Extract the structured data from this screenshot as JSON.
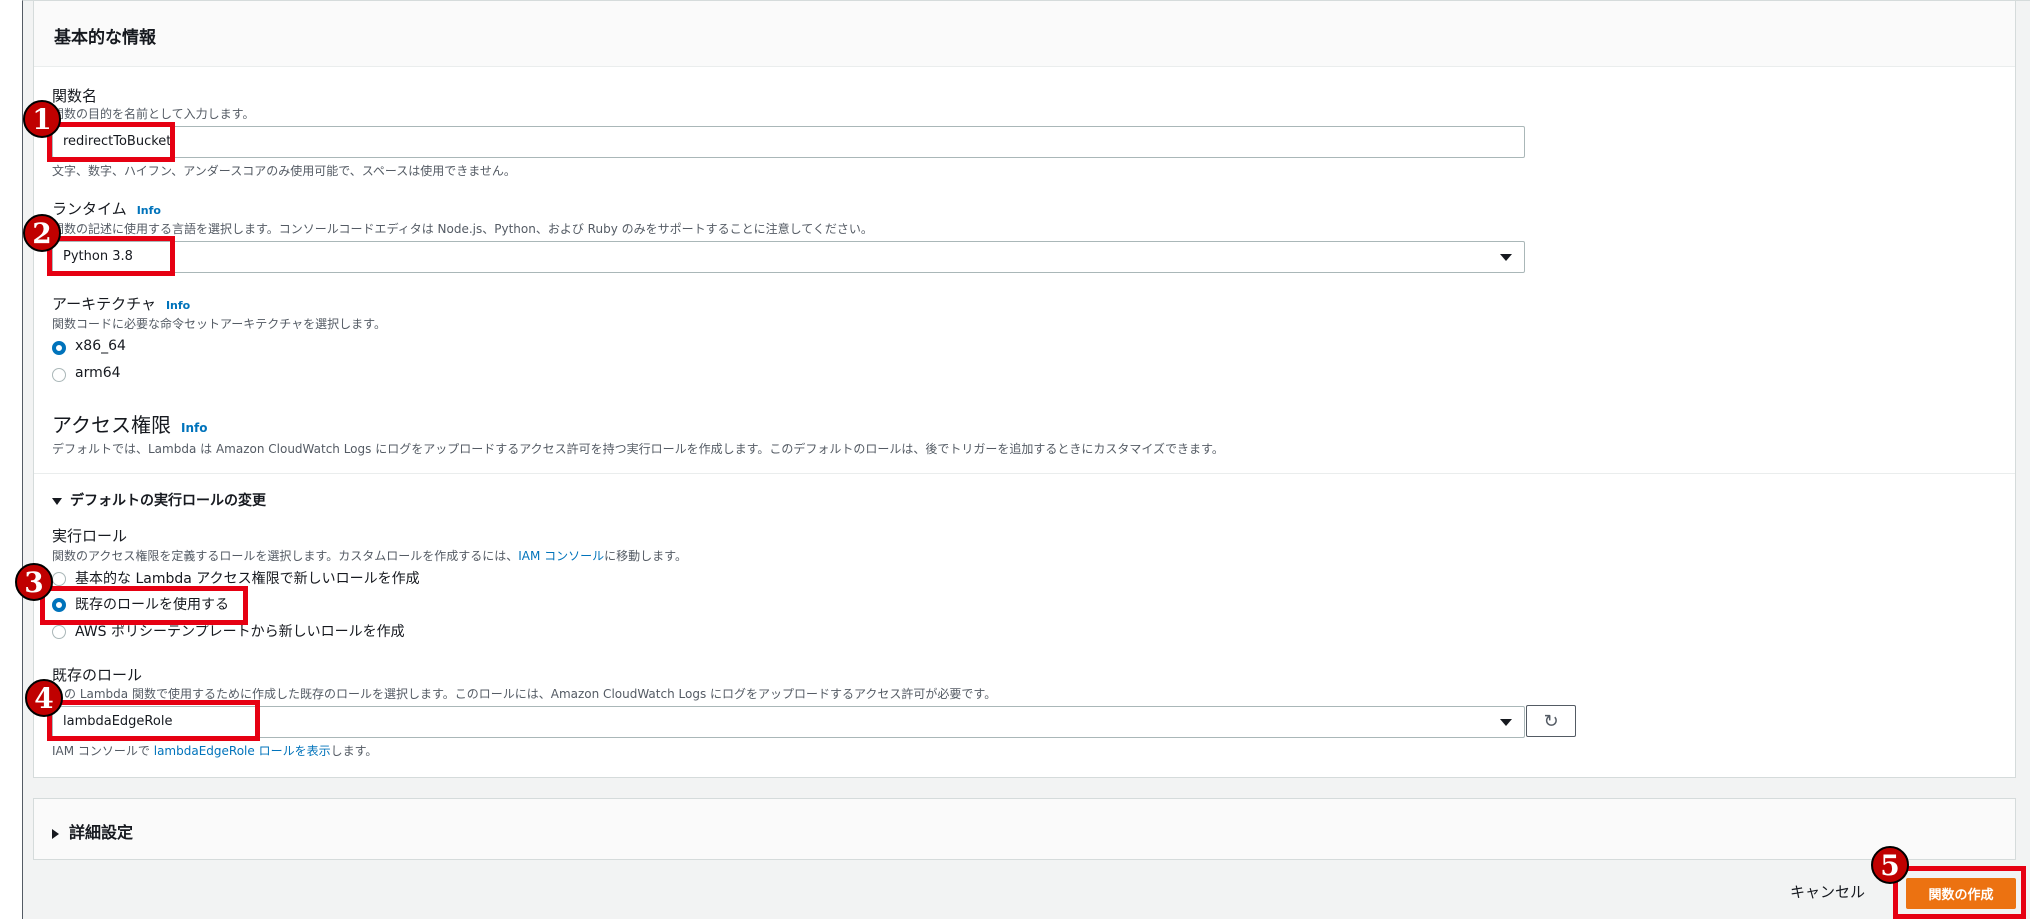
{
  "section": {
    "title": "基本的な情報"
  },
  "function_name": {
    "label": "関数名",
    "description": "関数の目的を名前として入力します。",
    "value": "redirectToBucket",
    "hint": "文字、数字、ハイフン、アンダースコアのみ使用可能で、スペースは使用できません。"
  },
  "runtime": {
    "label": "ランタイム",
    "info": "Info",
    "description": "関数の記述に使用する言語を選択します。コンソールコードエディタは Node.js、Python、および Ruby のみをサポートすることに注意してください。",
    "value": "Python 3.8"
  },
  "architecture": {
    "label": "アーキテクチャ",
    "info": "Info",
    "description": "関数コードに必要な命令セットアーキテクチャを選択します。",
    "options": [
      "x86_64",
      "arm64"
    ],
    "selected": "x86_64"
  },
  "permissions": {
    "title": "アクセス権限",
    "info": "Info",
    "description": "デフォルトでは、Lambda は Amazon CloudWatch Logs にログをアップロードするアクセス許可を持つ実行ロールを作成します。このデフォルトのロールは、後でトリガーを追加するときにカスタマイズできます。"
  },
  "default_role_toggle": "デフォルトの実行ロールの変更",
  "execution_role": {
    "label": "実行ロール",
    "description_prefix": "関数のアクセス権限を定義するロールを選択します。カスタムロールを作成するには、",
    "description_link": "IAM コンソール",
    "description_suffix": "に移動します。",
    "options": [
      "基本的な Lambda アクセス権限で新しいロールを作成",
      "既存のロールを使用する",
      "AWS ポリシーテンプレートから新しいロールを作成"
    ],
    "selected": "既存のロールを使用する"
  },
  "existing_role": {
    "label": "既存のロール",
    "description": "この Lambda 関数で使用するために作成した既存のロールを選択します。このロールには、Amazon CloudWatch Logs にログをアップロードするアクセス許可が必要です。",
    "value": "lambdaEdgeRole",
    "footer_prefix": "IAM コンソールで ",
    "footer_link": "lambdaEdgeRole ロールを表示",
    "footer_suffix": "します。"
  },
  "advanced": {
    "title": "詳細設定"
  },
  "actions": {
    "cancel": "キャンセル",
    "create": "関数の作成"
  },
  "annotations": [
    "1",
    "2",
    "3",
    "4",
    "5"
  ],
  "colors": {
    "accent": "#0073bb",
    "primary_button": "#ec7211",
    "highlight": "#e60012"
  }
}
